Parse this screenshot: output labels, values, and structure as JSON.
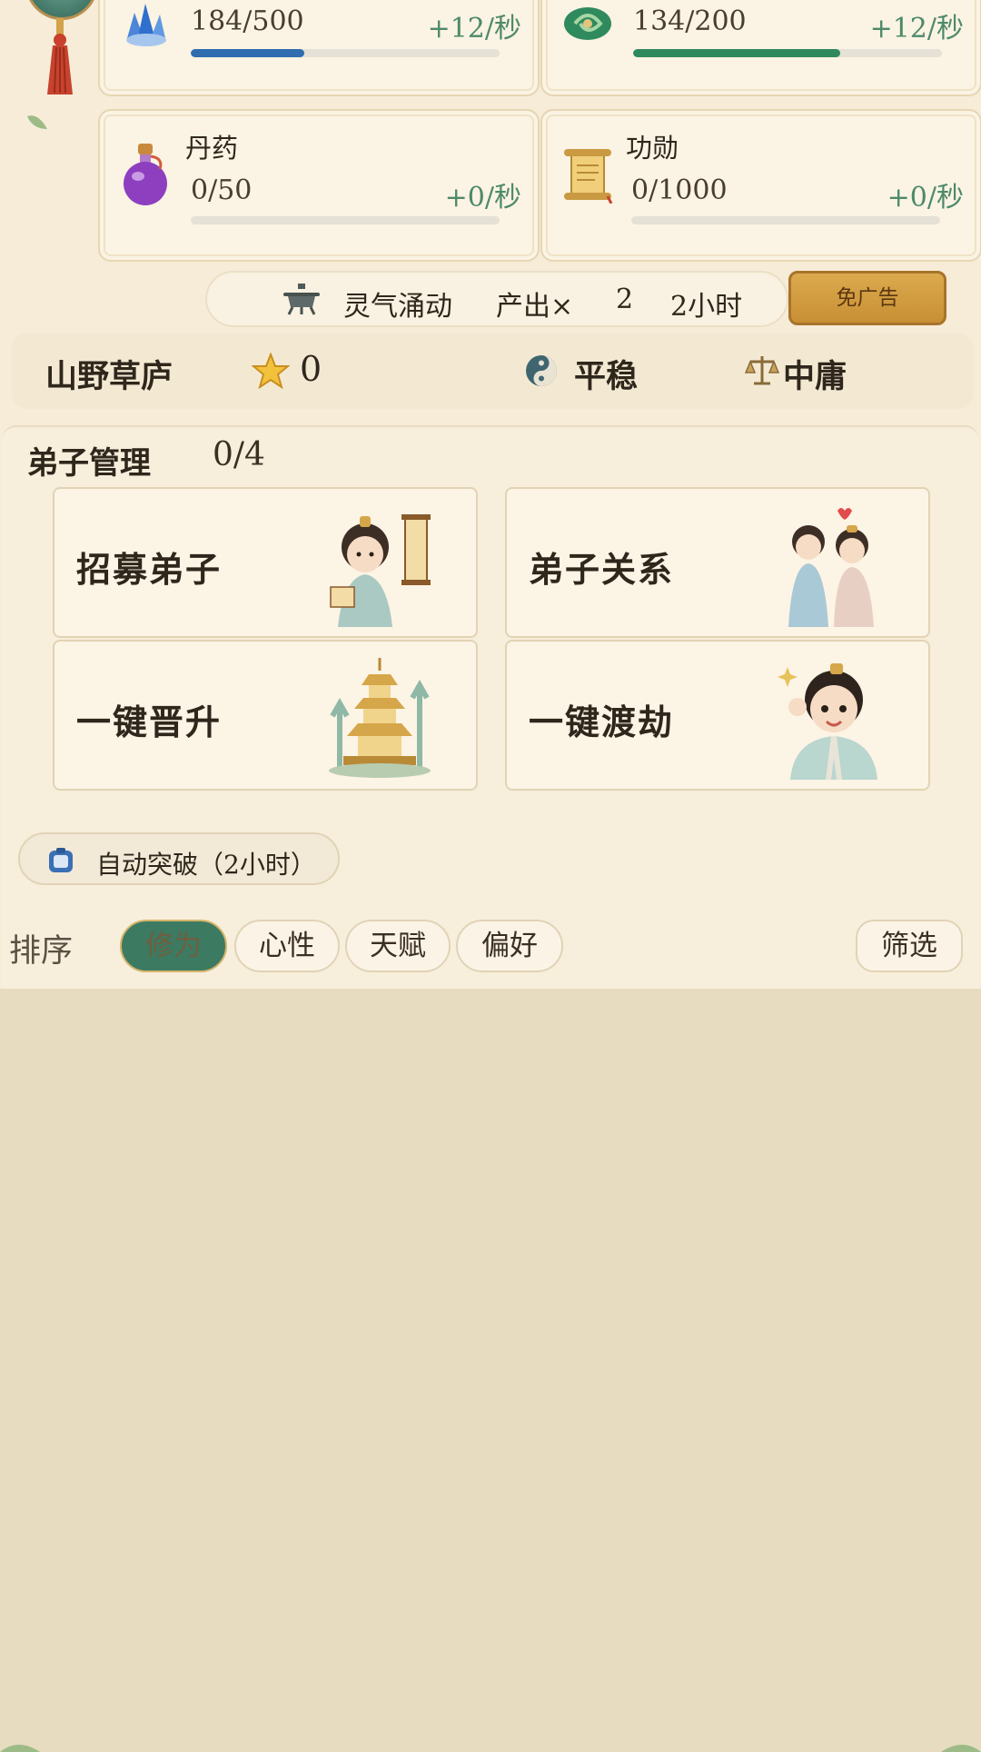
{
  "resources": [
    {
      "name": "",
      "value": "184/500",
      "rate": "+12/秒",
      "progress": 0.368,
      "bar_color": "#2f6db0",
      "icon": "blue-crystal-icon"
    },
    {
      "name": "",
      "value": "134/200",
      "rate": "+12/秒",
      "progress": 0.67,
      "bar_color": "#2e8a5c",
      "icon": "jade-coil-icon"
    },
    {
      "name": "丹药",
      "value": "0/50",
      "rate": "+0/秒",
      "progress": 0,
      "bar_color": "#2e8a5c",
      "icon": "purple-potion-icon"
    },
    {
      "name": "功勋",
      "value": "0/1000",
      "rate": "+0/秒",
      "progress": 0,
      "bar_color": "#2e8a5c",
      "icon": "scroll-icon"
    }
  ],
  "boost": {
    "icon": "incense-burner-icon",
    "name": "灵气涌动",
    "output_label": "产出×",
    "multiplier": "2",
    "duration": "2小时",
    "ad_button": "免广告"
  },
  "sect": {
    "name": "山野草庐",
    "stars": "0",
    "state": "平稳",
    "alignment": "中庸"
  },
  "disciples": {
    "title": "弟子管理",
    "count": "0/4",
    "actions": [
      {
        "label": "招募弟子",
        "art": "recruit-scroll-character-art"
      },
      {
        "label": "弟子关系",
        "art": "disciple-couple-art"
      },
      {
        "label": "一键晋升",
        "art": "golden-pagoda-art"
      },
      {
        "label": "一键渡劫",
        "art": "cheering-disciple-art"
      }
    ],
    "auto_breakthrough": "自动突破（2小时）"
  },
  "sort": {
    "label": "排序",
    "options": [
      "修为",
      "心性",
      "天赋",
      "偏好"
    ],
    "active": "修为",
    "filter": "筛选"
  },
  "colors": {
    "page_background": "#e7dcc0",
    "panel_background": "#f6ecd8",
    "rate_text": "#4c8a6a",
    "active_chip": "#3c7a62",
    "ad_button": "#d4a047"
  }
}
